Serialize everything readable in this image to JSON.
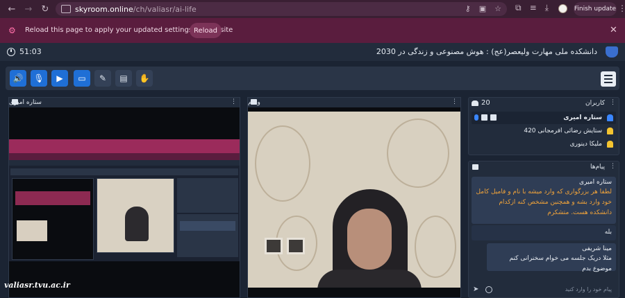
{
  "browser": {
    "url_host": "skyroom.online",
    "url_path": "/ch/valiasr/ai-life",
    "finish_update": "Finish update"
  },
  "banner": {
    "message": "Reload this page to apply your updated settings on this site",
    "reload_label": "Reload"
  },
  "header": {
    "timer": "51:03",
    "room_title": "دانشکده ملی مهارت ولیعصر(عج) : هوش مصنوعی و زندگی در 2030"
  },
  "panels": {
    "screen_share_title": "ستاره امیری",
    "webcam_title": "وبکم"
  },
  "users": {
    "title": "کاربران",
    "count": "20",
    "list": [
      {
        "name": "ستاره امیری",
        "color": "#3a86ff"
      },
      {
        "name": "ستایش رضائی افرمجانی 420",
        "color": "#f4c430"
      },
      {
        "name": "ملیکا دینوری",
        "color": "#f4c430"
      }
    ]
  },
  "chat": {
    "title": "پیام‌ها",
    "messages": [
      {
        "sender": "ستاره امیری",
        "text": "لطفا هر بزرگواری که وارد میشه با نام و فامیل کامل خود وارد بشه و همچنین مشخص کنه ازکدام دانشکده هست. متشکرم"
      },
      {
        "sender": "",
        "text": "بله"
      },
      {
        "sender": "مینا شریفی",
        "text": "مثلا دریک جلسه می خوام سخنرانی کنم موضوع بدم"
      }
    ],
    "input_placeholder": "پیام خود را وارد کنید"
  },
  "watermark": "valiasr.tvu.ac.ir"
}
